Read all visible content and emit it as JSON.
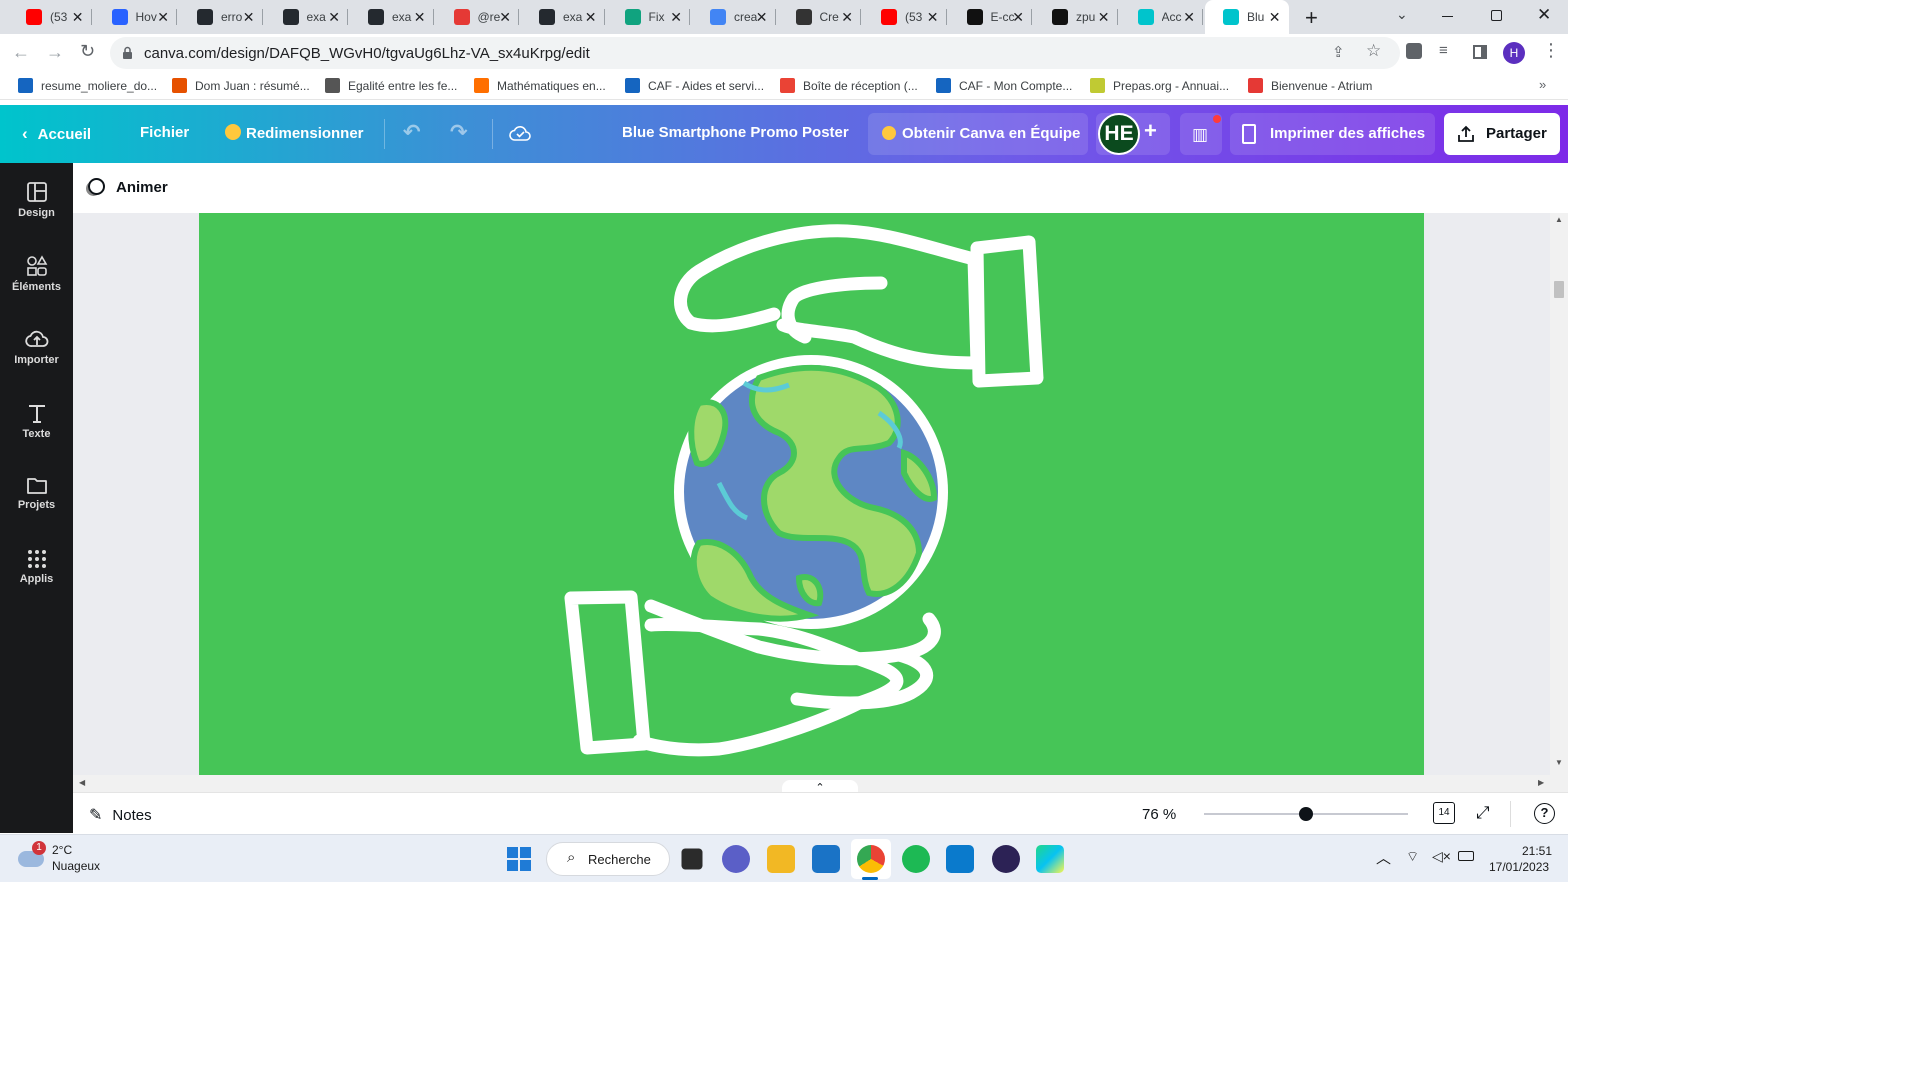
{
  "browser": {
    "tabs": [
      {
        "title": "(53",
        "icon": "youtube-icon",
        "color": "#ff0000"
      },
      {
        "title": "Hov",
        "icon": "q-icon",
        "color": "#2962ff"
      },
      {
        "title": "erro",
        "icon": "github-icon",
        "color": "#24292f"
      },
      {
        "title": "exa",
        "icon": "github-icon",
        "color": "#24292f"
      },
      {
        "title": "exa",
        "icon": "github-icon",
        "color": "#24292f"
      },
      {
        "title": "@re",
        "icon": "n-icon",
        "color": "#e53935"
      },
      {
        "title": "exa",
        "icon": "github-icon",
        "color": "#24292f"
      },
      {
        "title": "Fix",
        "icon": "openai-icon",
        "color": "#10a37f"
      },
      {
        "title": "crea",
        "icon": "google-icon",
        "color": "#4285f4"
      },
      {
        "title": "Cre",
        "icon": "cap-icon",
        "color": "#333333"
      },
      {
        "title": "(53",
        "icon": "youtube-icon",
        "color": "#ff0000"
      },
      {
        "title": "E-cc",
        "icon": "bracket-icon",
        "color": "#111111"
      },
      {
        "title": "zpu",
        "icon": "bracket-icon",
        "color": "#111111"
      },
      {
        "title": "Acc",
        "icon": "canva-icon",
        "color": "#00c4cc"
      },
      {
        "title": "Blu",
        "icon": "canva-icon",
        "color": "#00c4cc",
        "active": true
      }
    ],
    "url": "canva.com/design/DAFQB_WGvH0/tgvaUg6Lhz-VA_sx4uKrpg/edit",
    "profile_initial": "H",
    "bookmarks": [
      {
        "label": "resume_moliere_do...",
        "color": "#1565c0"
      },
      {
        "label": "Dom Juan : résumé...",
        "color": "#e65100"
      },
      {
        "label": "Egalité entre les fe...",
        "color": "#555555"
      },
      {
        "label": "Mathématiques en...",
        "color": "#ff6f00"
      },
      {
        "label": "CAF - Aides et servi...",
        "color": "#1565c0"
      },
      {
        "label": "Boîte de réception (...",
        "color": "#ea4335"
      },
      {
        "label": "CAF - Mon Compte...",
        "color": "#1565c0"
      },
      {
        "label": "Prepas.org - Annuai...",
        "color": "#c0ca33"
      },
      {
        "label": "Bienvenue - Atrium",
        "color": "#e53935"
      }
    ]
  },
  "canva": {
    "home": "Accueil",
    "file": "Fichier",
    "resize": "Redimensionner",
    "design_title": "Blue Smartphone Promo Poster",
    "team": "Obtenir Canva en Équipe",
    "avatar": "HE",
    "print": "Imprimer des affiches",
    "share": "Partager",
    "animate": "Animer",
    "sidebar": [
      {
        "label": "Design",
        "icon": "layout-icon"
      },
      {
        "label": "Éléments",
        "icon": "shapes-icon"
      },
      {
        "label": "Importer",
        "icon": "upload-cloud-icon"
      },
      {
        "label": "Texte",
        "icon": "text-icon"
      },
      {
        "label": "Projets",
        "icon": "folder-icon"
      },
      {
        "label": "Applis",
        "icon": "grid-icon"
      }
    ],
    "notes": "Notes",
    "zoom": "76 %",
    "zoom_fraction": 0.5,
    "page_count": "14",
    "canvas_color": "#46c557"
  },
  "taskbar": {
    "temp": "2°C",
    "weather": "Nuageux",
    "weather_badge": "1",
    "search": "Recherche",
    "time": "21:51",
    "date": "17/01/2023"
  }
}
